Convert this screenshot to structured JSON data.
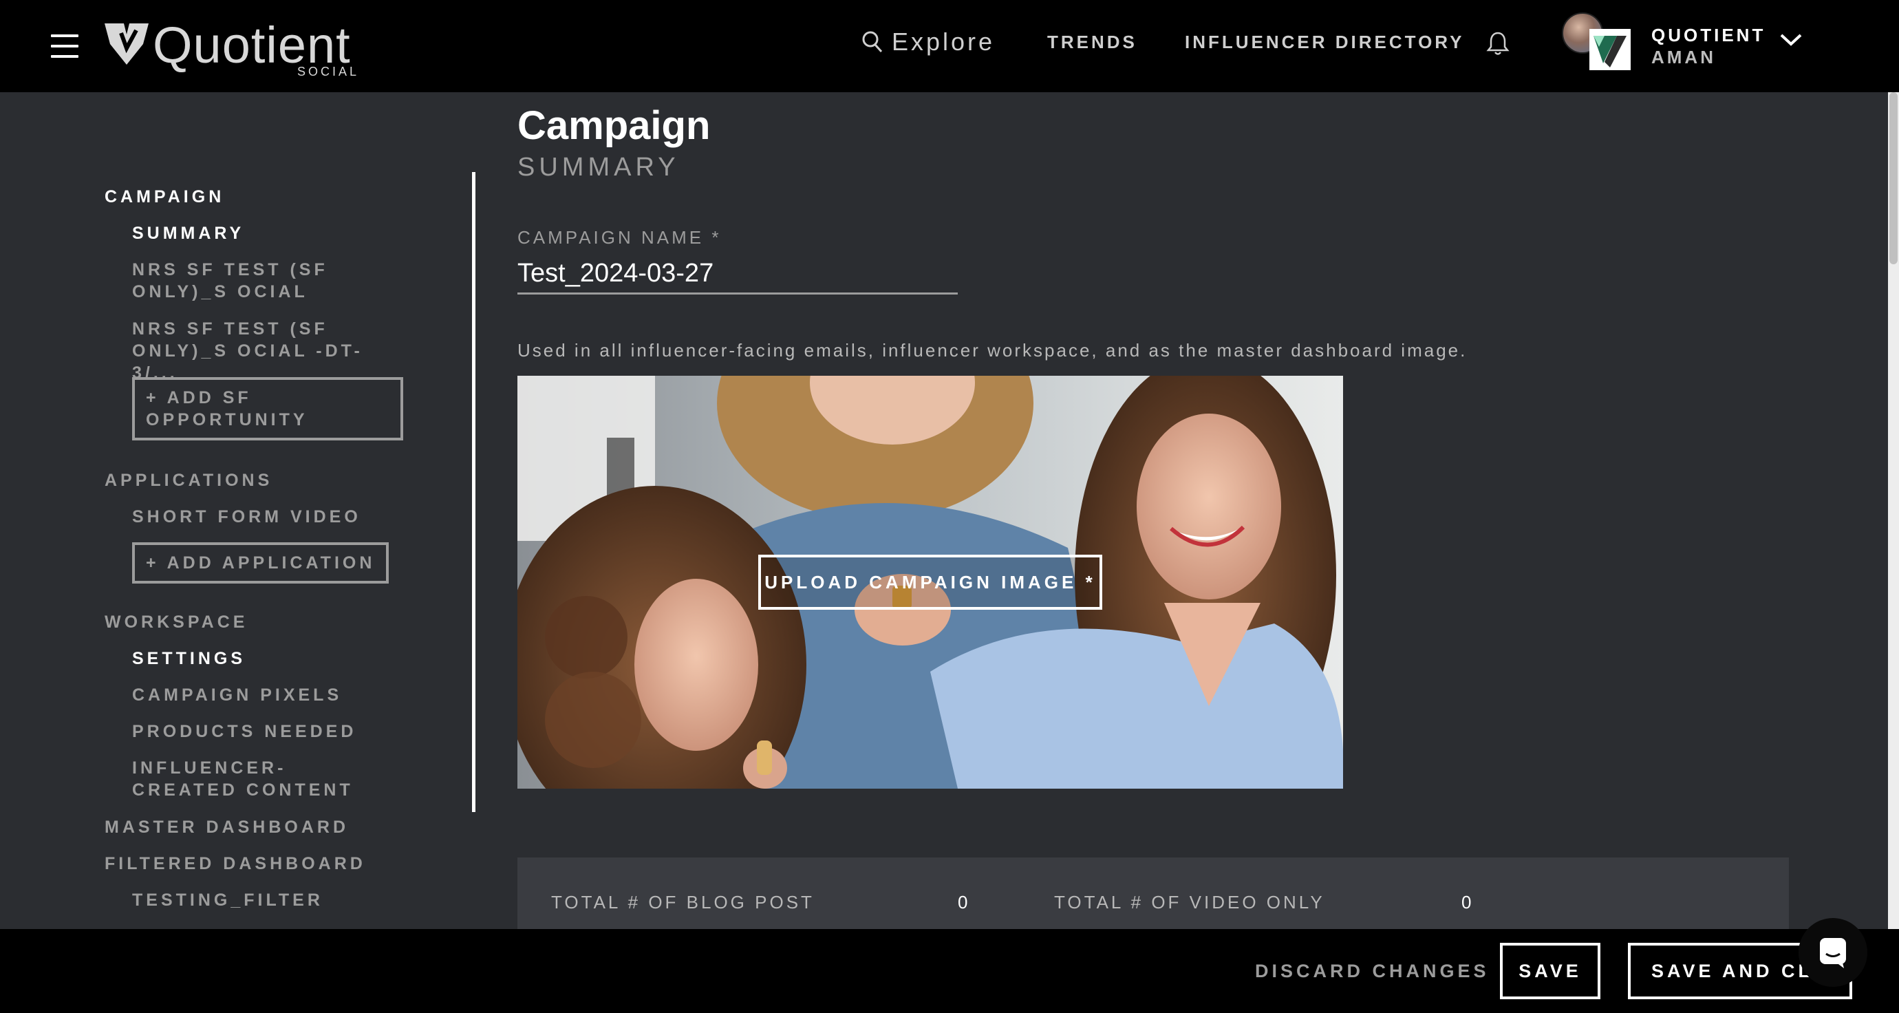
{
  "header": {
    "logo_text": "Quotient",
    "logo_subtext": "SOCIAL",
    "explore_label": "Explore",
    "nav_trends": "TRENDS",
    "nav_directory": "INFLUENCER DIRECTORY",
    "user_org": "QUOTIENT",
    "user_name": "AMAN"
  },
  "sidebar": {
    "campaign": "CAMPAIGN",
    "summary": "SUMMARY",
    "sf_item_1": "NRS SF TEST (SF ONLY)_S OCIAL",
    "sf_item_2": "NRS SF TEST (SF ONLY)_S OCIAL -DT-3/...",
    "add_sf": "+ ADD SF OPPORTUNITY",
    "applications": "APPLICATIONS",
    "short_form_video": "SHORT FORM VIDEO",
    "add_application": "+ ADD APPLICATION",
    "workspace": "WORKSPACE",
    "settings": "SETTINGS",
    "campaign_pixels": "CAMPAIGN PIXELS",
    "products_needed": "PRODUCTS NEEDED",
    "influencer_content": "INFLUENCER-CREATED CONTENT",
    "master_dashboard": "MASTER DASHBOARD",
    "filtered_dashboard": "FILTERED DASHBOARD",
    "testing_filter": "TESTING_FILTER"
  },
  "main": {
    "title": "Campaign",
    "subtitle": "SUMMARY",
    "name_label": "CAMPAIGN NAME *",
    "name_value": "Test_2024-03-27",
    "helper_text": "Used in all influencer-facing emails, influencer workspace, and as the master dashboard image.",
    "upload_label": "UPLOAD CAMPAIGN IMAGE *"
  },
  "stats": {
    "blog_label": "TOTAL # OF BLOG POST",
    "blog_value": "0",
    "video_only_label": "TOTAL # OF VIDEO ONLY",
    "video_only_value": "0"
  },
  "footer": {
    "discard": "DISCARD CHANGES",
    "save": "SAVE",
    "save_close": "SAVE AND CLOSE"
  }
}
